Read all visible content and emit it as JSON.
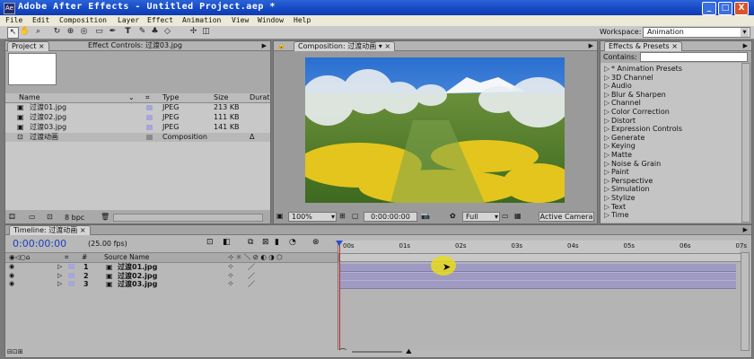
{
  "title_bar": {
    "title": "Adobe After Effects - Untitled Project.aep *",
    "min": "_",
    "max": "□",
    "close": "X"
  },
  "menu": [
    "File",
    "Edit",
    "Composition",
    "Layer",
    "Effect",
    "Animation",
    "View",
    "Window",
    "Help"
  ],
  "workspace": {
    "label": "Workspace:",
    "value": "Animation"
  },
  "project_panel": {
    "tab_project": "Project",
    "tab_effect_controls": "Effect Controls: 过渡03.jpg",
    "columns": {
      "name": "Name",
      "type": "Type",
      "size": "Size",
      "duration": "Durat"
    },
    "items": [
      {
        "name": "过渡01.jpg",
        "type": "JPEG",
        "size": "213 KB",
        "label_color": "#a6a6d8"
      },
      {
        "name": "过渡02.jpg",
        "type": "JPEG",
        "size": "111 KB",
        "label_color": "#a6a6d8"
      },
      {
        "name": "过渡03.jpg",
        "type": "JPEG",
        "size": "141 KB",
        "label_color": "#a6a6d8"
      },
      {
        "name": "过渡动画",
        "type": "Composition",
        "size": "",
        "duration": "Δ",
        "label_color": "#8a8a8a"
      }
    ],
    "bpc": "8 bpc"
  },
  "comp_panel": {
    "tab": "Composition: 过渡动画",
    "zoom": "100%",
    "timecode": "0:00:00:00",
    "resolution": "Full",
    "camera": "Active Camera"
  },
  "effects_panel": {
    "tab": "Effects & Presets",
    "contains_label": "Contains:",
    "items": [
      "* Animation Presets",
      "3D Channel",
      "Audio",
      "Blur & Sharpen",
      "Channel",
      "Color Correction",
      "Distort",
      "Expression Controls",
      "Generate",
      "Keying",
      "Matte",
      "Noise & Grain",
      "Paint",
      "Perspective",
      "Simulation",
      "Stylize",
      "Text",
      "Time"
    ]
  },
  "timeline": {
    "tab": "Timeline: 过渡动画",
    "timecode": "0:00:00:00",
    "fps": "(25.00 fps)",
    "source_name_header": "Source Name",
    "hash_header": "#",
    "ticks": [
      "00s",
      "01s",
      "02s",
      "03s",
      "04s",
      "05s",
      "06s",
      "07s"
    ],
    "layers": [
      {
        "num": "1",
        "name": "过渡01.jpg"
      },
      {
        "num": "2",
        "name": "过渡02.jpg"
      },
      {
        "num": "3",
        "name": "过渡03.jpg"
      }
    ]
  },
  "colors": {
    "accent": "#2b63d8",
    "bar": "#9e9ac2",
    "playhead": "#d12020",
    "timecode": "#1b3fbf"
  }
}
